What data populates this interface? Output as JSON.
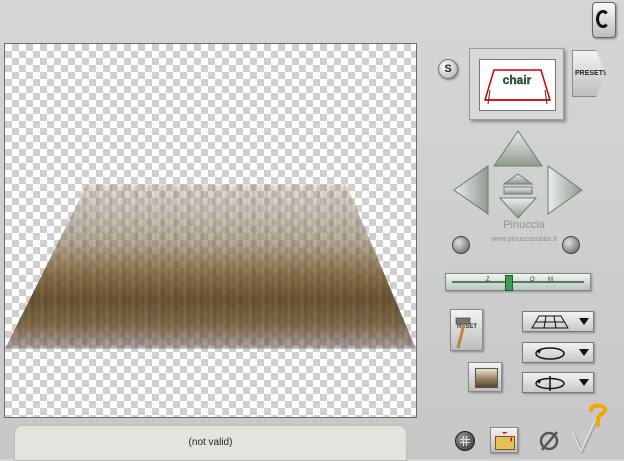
{
  "status": {
    "text": "(not valid)"
  },
  "presets": {
    "label": "PRESETS"
  },
  "s_button": {
    "label": "S"
  },
  "reset": {
    "label": "RESET"
  },
  "thumbnail": {
    "text": "chair"
  },
  "watermark": {
    "line1": "Pinuccia",
    "line2": "www.pinucciarobbo.it"
  },
  "slider": {
    "ticks": [
      "Z",
      "O",
      "M"
    ]
  },
  "icons": {
    "logo": "c-logo-icon",
    "grid": "grid-icon",
    "folder": "folder-arrow-icon",
    "cancel": "cancel-icon",
    "ok": "checkmark-icon",
    "help": "help-icon"
  }
}
